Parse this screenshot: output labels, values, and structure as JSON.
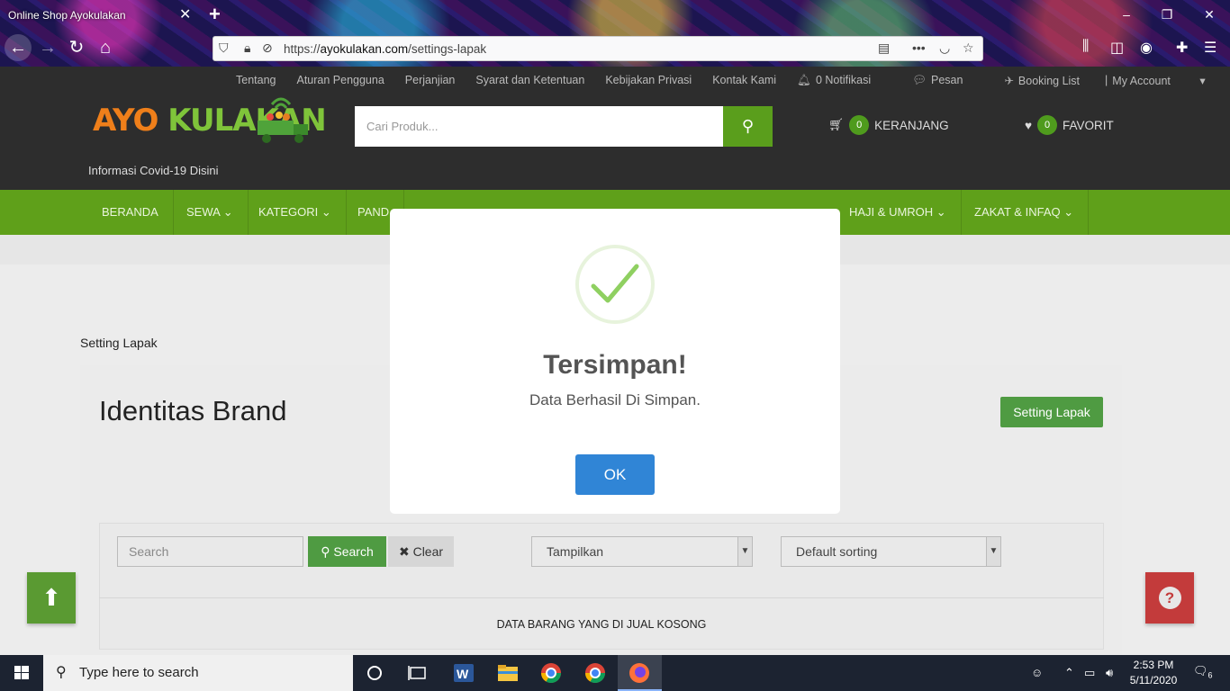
{
  "browser": {
    "tab_title": "Online Shop Ayokulakan",
    "url_prefix": "https://",
    "url_host": "ayokulakan.com",
    "url_path": "/settings-lapak"
  },
  "site": {
    "top_links": [
      "Tentang",
      "Aturan Pengguna",
      "Perjanjian",
      "Syarat dan Ketentuan",
      "Kebijakan Privasi",
      "Kontak Kami"
    ],
    "notifications": "0 Notifikasi",
    "messages": "Pesan",
    "booking": "Booking List",
    "separator": "|",
    "account": "My Account",
    "logo_part1": "AYO",
    "logo_part2": "KULAKAN",
    "covid_link": "Informasi Covid-19 Disini",
    "search_placeholder": "Cari Produk...",
    "cart_count": "0",
    "cart_label": "KERANJANG",
    "fav_count": "0",
    "fav_label": "FAVORIT"
  },
  "menu": {
    "beranda": "BERANDA",
    "sewa": "SEWA",
    "kategori": "KATEGORI",
    "pand": "PAND",
    "haji": "HAJI & UMROH",
    "zakat": "ZAKAT & INFAQ"
  },
  "page": {
    "breadcrumb": "Setting Lapak",
    "title": "Identitas Brand",
    "setting_button": "Setting Lapak",
    "search_placeholder": "Search",
    "search_button": "Search",
    "clear_button": "Clear",
    "show_select": "Tampilkan",
    "sort_select": "Default sorting",
    "empty_message": "DATA BARANG YANG DI JUAL KOSONG"
  },
  "modal": {
    "title": "Tersimpan!",
    "text": "Data Berhasil Di Simpan.",
    "ok_button": "OK"
  },
  "taskbar": {
    "search_placeholder": "Type here to search",
    "time": "2:53 PM",
    "date": "5/11/2020",
    "notification_count": "6"
  },
  "colors": {
    "brand_green": "#5fa01a",
    "button_green": "#4f9b42",
    "ok_blue": "#3085d6",
    "help_red": "#c33b3b",
    "logo_orange": "#ef7f1a"
  }
}
